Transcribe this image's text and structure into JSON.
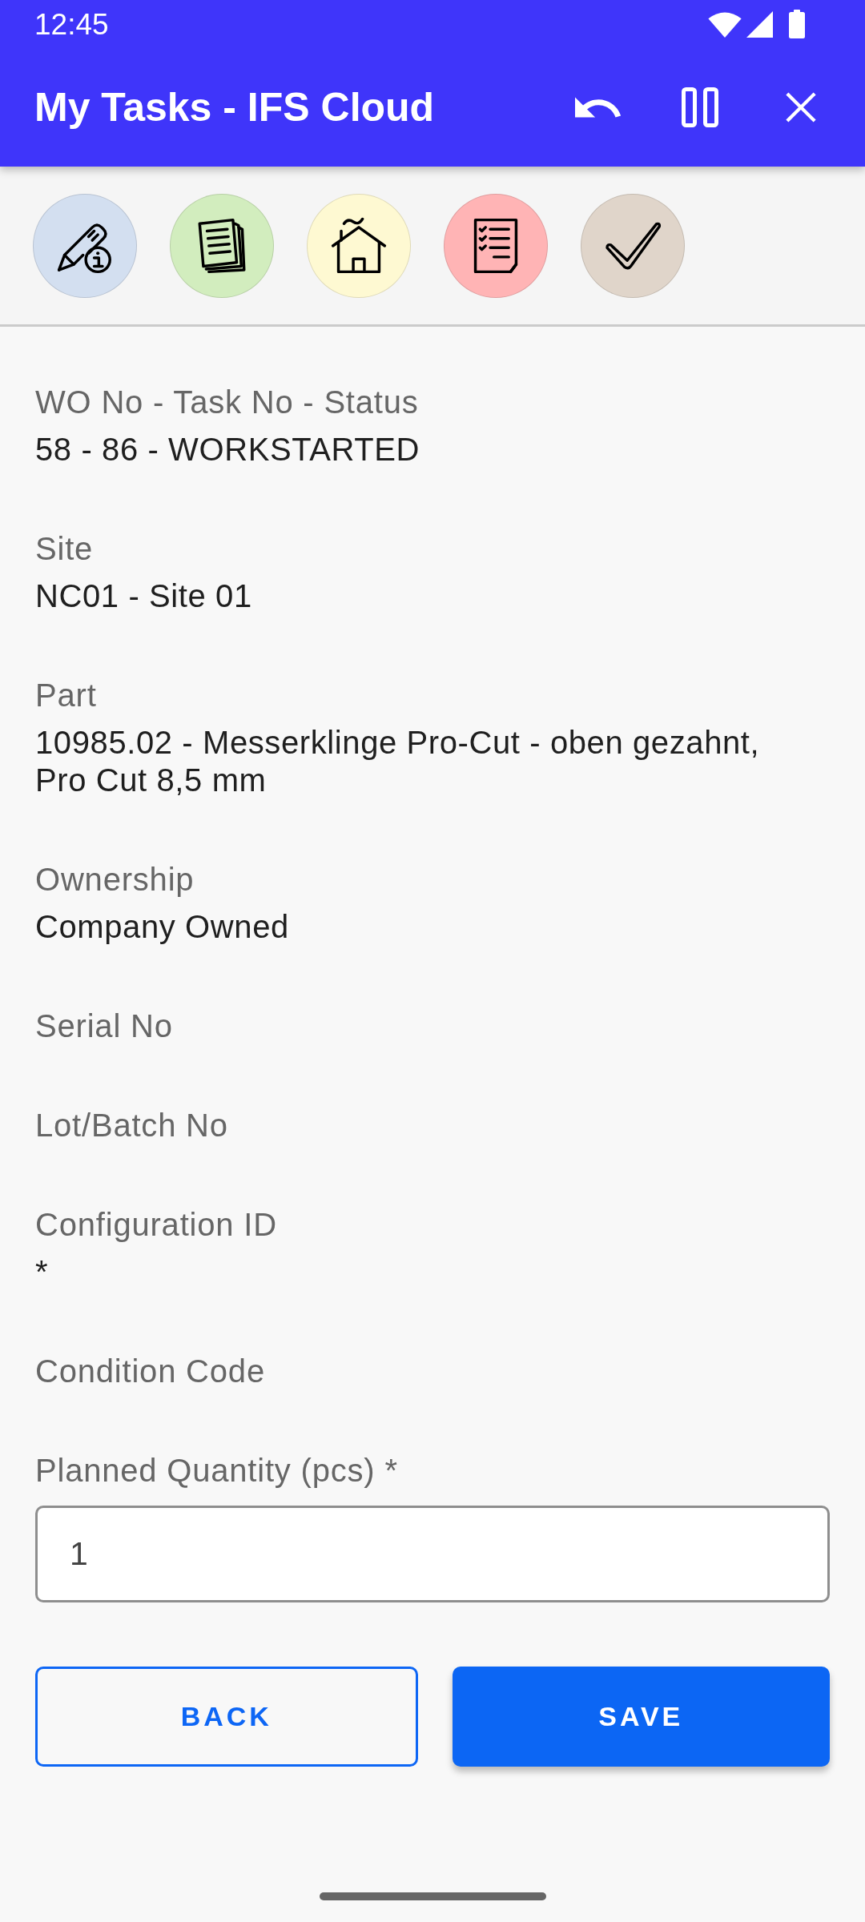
{
  "status_bar": {
    "time": "12:45"
  },
  "app_bar": {
    "title": "My Tasks - IFS Cloud"
  },
  "shortcuts": [
    {
      "kind": "edit",
      "color": "#d3dff0"
    },
    {
      "kind": "documents",
      "color": "#d2edbe"
    },
    {
      "kind": "home",
      "color": "#fef9d2"
    },
    {
      "kind": "checklist",
      "color": "#ffb4b5"
    },
    {
      "kind": "check",
      "color": "#e0d5ca"
    }
  ],
  "fields": [
    {
      "label": "WO No - Task No - Status",
      "value": "58 - 86 - WORKSTARTED"
    },
    {
      "label": "Site",
      "value": "NC01 - Site 01"
    },
    {
      "label": "Part",
      "value": "10985.02 - Messerklinge Pro-Cut - oben gezahnt, Pro Cut 8,5 mm"
    },
    {
      "label": "Ownership",
      "value": "Company Owned"
    },
    {
      "label": "Serial No"
    },
    {
      "label": "Lot/Batch No"
    },
    {
      "label": "Configuration ID",
      "value": "*"
    },
    {
      "label": "Condition Code"
    }
  ],
  "quantity_field": {
    "label": "Planned Quantity (pcs) *",
    "value": "1"
  },
  "buttons": [
    {
      "label": "BACK",
      "kind": "outlined"
    },
    {
      "label": "SAVE",
      "kind": "filled"
    }
  ]
}
